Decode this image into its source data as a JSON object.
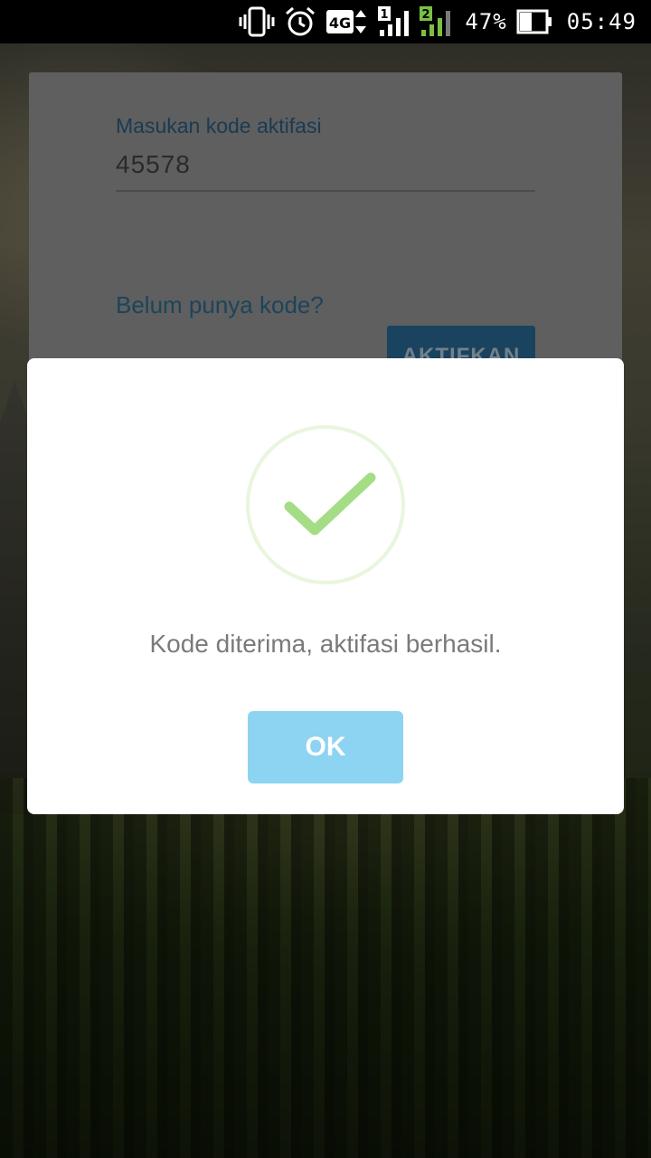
{
  "status_bar": {
    "icons": [
      "vibrate-icon",
      "alarm-icon",
      "network-4g-icon",
      "signal-sim1-icon",
      "signal-sim2-icon",
      "battery-icon"
    ],
    "network_type": "4G",
    "sim1_label": "1",
    "sim2_label": "2",
    "battery_percent": "47%",
    "battery_level": 0.47,
    "time": "05:49"
  },
  "activation_form": {
    "field_label": "Masukan kode aktifasi",
    "field_value": "45578",
    "no_code_link": "Belum punya kode?",
    "activate_button": "AKTIFKAN"
  },
  "dialog": {
    "icon": "success-check-icon",
    "message": "Kode diterima, aktifasi berhasil.",
    "ok_button": "OK"
  },
  "colors": {
    "accent_link": "#2e6f94",
    "ok_button": "#8dd3f2",
    "success_check": "#a5dc86",
    "success_ring": "#e8f6de"
  }
}
